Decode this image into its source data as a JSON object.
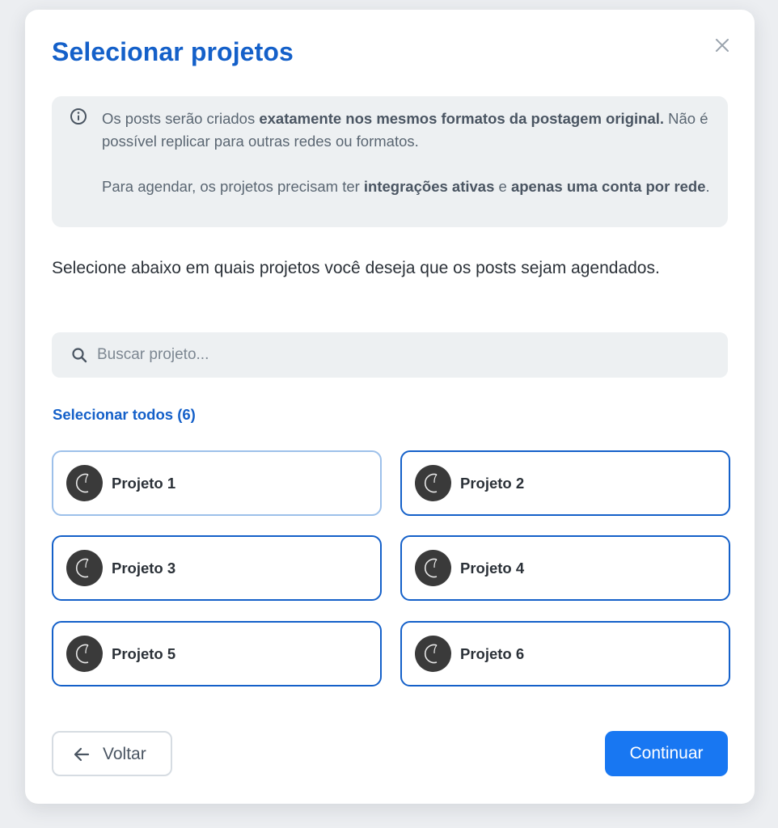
{
  "modal": {
    "title": "Selecionar projetos",
    "info": {
      "p1_part1": "Os posts serão criados ",
      "p1_bold1": "exatamente nos mesmos formatos da postagem original.",
      "p1_part2": " Não é possível replicar para outras redes ou formatos.",
      "p2_part1": "Para agendar, os projetos precisam ter ",
      "p2_bold1": "integrações ativas",
      "p2_part2": " e ",
      "p2_bold2": "apenas uma conta por rede",
      "p2_part3": "."
    },
    "subtitle": "Selecione abaixo em quais projetos você deseja que os posts sejam agendados.",
    "search": {
      "placeholder": "Buscar projeto..."
    },
    "select_all_label": "Selecionar todos (6)",
    "projects": [
      {
        "name": "Projeto 1"
      },
      {
        "name": "Projeto 2"
      },
      {
        "name": "Projeto 3"
      },
      {
        "name": "Projeto 4"
      },
      {
        "name": "Projeto 5"
      },
      {
        "name": "Projeto 6"
      }
    ],
    "back_label": "Voltar",
    "continue_label": "Continuar"
  },
  "colors": {
    "accent": "#1460c9",
    "primary_button": "#1877f2",
    "info_bg": "#edf0f2",
    "selected_border": "#1460c9",
    "focused_border": "#9dc0ea"
  },
  "icons": [
    "close-icon",
    "info-icon",
    "search-icon",
    "project-avatar-icon",
    "arrow-left-icon"
  ]
}
